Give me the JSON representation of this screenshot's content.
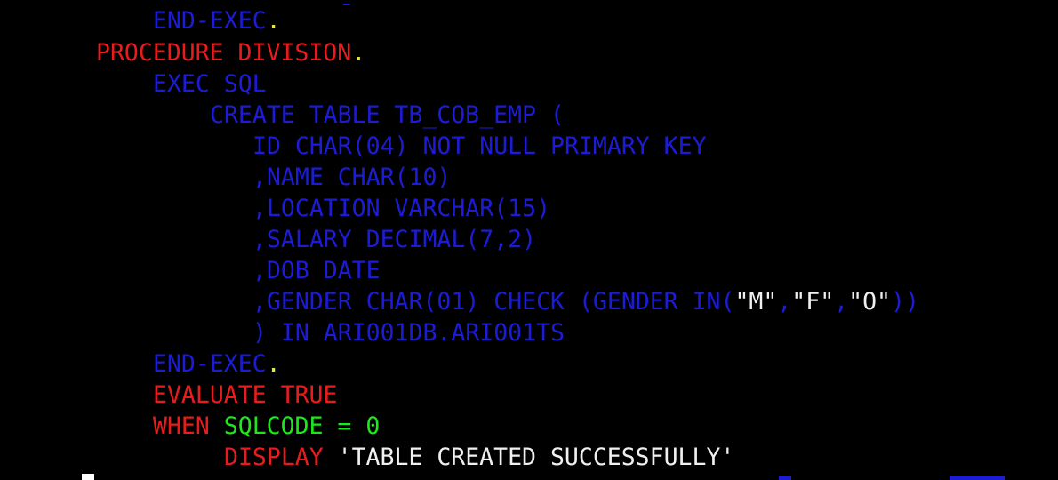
{
  "colors": {
    "background": "#000000",
    "keyword_blue": "#1c1cd6",
    "division_red": "#e81c1c",
    "sqlcode_green": "#1ce81c",
    "literal_white": "#f0f0f0",
    "period_yellow": "#e8e84a",
    "cursor": "#ffffff"
  },
  "terminal": {
    "lines": [
      {
        "tokens": [
          {
            "text": "END-EXEC",
            "color": "#1c1cd6"
          },
          {
            "text": ".",
            "color": "#e8e84a"
          }
        ]
      },
      {
        "tokens": [
          {
            "text": "PROCEDURE DIVISION",
            "color": "#e81c1c"
          },
          {
            "text": ".",
            "color": "#e8e84a"
          }
        ]
      },
      {
        "tokens": [
          {
            "text": "EXEC SQL",
            "color": "#1c1cd6"
          }
        ]
      },
      {
        "tokens": [
          {
            "text": "CREATE TABLE TB_COB_EMP (",
            "color": "#1c1cd6"
          }
        ]
      },
      {
        "tokens": [
          {
            "text": "ID CHAR(04) NOT NULL PRIMARY KEY",
            "color": "#1c1cd6"
          }
        ]
      },
      {
        "tokens": [
          {
            "text": ",NAME CHAR(10)",
            "color": "#1c1cd6"
          }
        ]
      },
      {
        "tokens": [
          {
            "text": ",LOCATION VARCHAR(15)",
            "color": "#1c1cd6"
          }
        ]
      },
      {
        "tokens": [
          {
            "text": ",SALARY DECIMAL(7,2)",
            "color": "#1c1cd6"
          }
        ]
      },
      {
        "tokens": [
          {
            "text": ",DOB DATE",
            "color": "#1c1cd6"
          }
        ]
      },
      {
        "tokens": [
          {
            "text": ",GENDER CHAR(01) CHECK (GENDER IN(",
            "color": "#1c1cd6"
          },
          {
            "text": "\"M\"",
            "color": "#f0f0f0"
          },
          {
            "text": ",",
            "color": "#1c1cd6"
          },
          {
            "text": "\"F\"",
            "color": "#f0f0f0"
          },
          {
            "text": ",",
            "color": "#1c1cd6"
          },
          {
            "text": "\"O\"",
            "color": "#f0f0f0"
          },
          {
            "text": "))",
            "color": "#1c1cd6"
          }
        ]
      },
      {
        "tokens": [
          {
            "text": ") IN ARI001DB.ARI001TS",
            "color": "#1c1cd6"
          }
        ]
      },
      {
        "tokens": [
          {
            "text": "END-EXEC",
            "color": "#1c1cd6"
          },
          {
            "text": ".",
            "color": "#e8e84a"
          }
        ]
      },
      {
        "tokens": [
          {
            "text": "EVALUATE TRUE",
            "color": "#e81c1c"
          }
        ]
      },
      {
        "tokens": [
          {
            "text": "WHEN ",
            "color": "#e81c1c"
          },
          {
            "text": "SQLCODE = 0",
            "color": "#1ce81c"
          }
        ]
      },
      {
        "tokens": [
          {
            "text": "DISPLAY ",
            "color": "#e81c1c"
          },
          {
            "text": "'TABLE CREATED SUCCESSFULLY'",
            "color": "#f0f0f0"
          }
        ]
      }
    ]
  }
}
